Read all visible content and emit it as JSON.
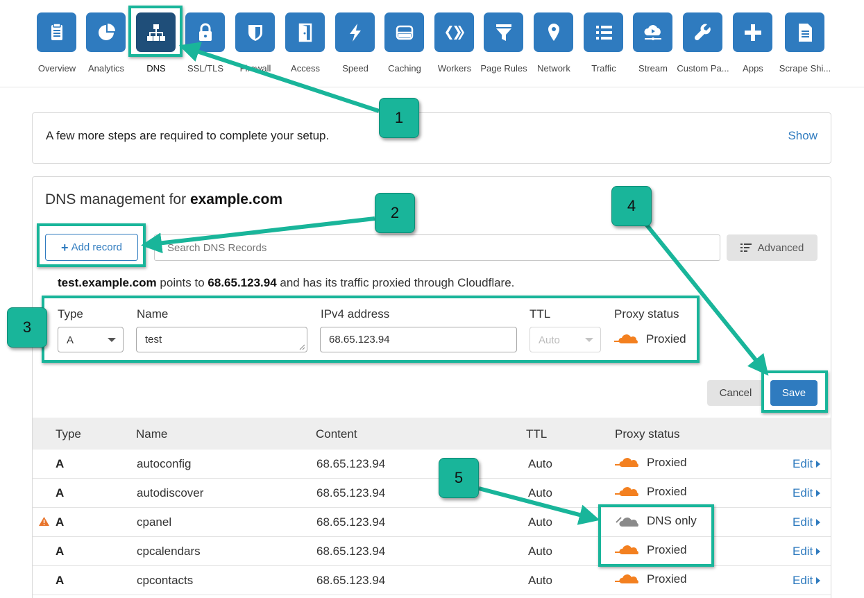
{
  "nav": {
    "items": [
      {
        "label": "Overview",
        "icon": "document-icon"
      },
      {
        "label": "Analytics",
        "icon": "pie-chart-icon"
      },
      {
        "label": "DNS",
        "icon": "network-tree-icon"
      },
      {
        "label": "SSL/TLS",
        "icon": "lock-icon"
      },
      {
        "label": "Firewall",
        "icon": "shield-icon"
      },
      {
        "label": "Access",
        "icon": "door-icon"
      },
      {
        "label": "Speed",
        "icon": "lightning-icon"
      },
      {
        "label": "Caching",
        "icon": "drive-icon"
      },
      {
        "label": "Workers",
        "icon": "workers-chevrons-icon"
      },
      {
        "label": "Page Rules",
        "icon": "filter-icon"
      },
      {
        "label": "Network",
        "icon": "location-pin-icon"
      },
      {
        "label": "Traffic",
        "icon": "list-icon"
      },
      {
        "label": "Stream",
        "icon": "cloud-stream-icon"
      },
      {
        "label": "Custom Pa...",
        "icon": "wrench-icon"
      },
      {
        "label": "Apps",
        "icon": "plus-icon"
      },
      {
        "label": "Scrape Shi...",
        "icon": "page-icon"
      }
    ],
    "active": "DNS"
  },
  "banner": {
    "text": "A few more steps are required to complete your setup.",
    "show_label": "Show"
  },
  "dns": {
    "title_prefix": "DNS management for ",
    "domain": "example.com",
    "add_record_label": "Add record",
    "add_record_plus": "+",
    "search_placeholder": "Search DNS Records",
    "advanced_label": "Advanced",
    "points": {
      "host": "test.example.com",
      "mid": " points to ",
      "ip": "68.65.123.94",
      "tail": " and has its traffic proxied through Cloudflare."
    },
    "form": {
      "type_label": "Type",
      "type_value": "A",
      "name_label": "Name",
      "name_value": "test",
      "ipv4_label": "IPv4 address",
      "ipv4_value": "68.65.123.94",
      "ttl_label": "TTL",
      "ttl_value": "Auto",
      "proxy_label": "Proxy status",
      "proxy_value": "Proxied"
    },
    "cancel_label": "Cancel",
    "save_label": "Save"
  },
  "table": {
    "headers": {
      "type": "Type",
      "name": "Name",
      "content": "Content",
      "ttl": "TTL",
      "proxy": "Proxy status"
    },
    "edit_label": "Edit",
    "rows": [
      {
        "type": "A",
        "name": "autoconfig",
        "content": "68.65.123.94",
        "ttl": "Auto",
        "proxy": "Proxied",
        "warning": false
      },
      {
        "type": "A",
        "name": "autodiscover",
        "content": "68.65.123.94",
        "ttl": "Auto",
        "proxy": "Proxied",
        "warning": false
      },
      {
        "type": "A",
        "name": "cpanel",
        "content": "68.65.123.94",
        "ttl": "Auto",
        "proxy": "DNS only",
        "warning": true
      },
      {
        "type": "A",
        "name": "cpcalendars",
        "content": "68.65.123.94",
        "ttl": "Auto",
        "proxy": "Proxied",
        "warning": false
      },
      {
        "type": "A",
        "name": "cpcontacts",
        "content": "68.65.123.94",
        "ttl": "Auto",
        "proxy": "Proxied",
        "warning": false
      }
    ]
  },
  "callouts": [
    "1",
    "2",
    "3",
    "4",
    "5"
  ],
  "colors": {
    "accent": "#2f7bbf",
    "nav_active": "#1f4e79",
    "annotation": "#19b59a",
    "proxied_cloud": "#f38020",
    "dns_only_cloud": "#8a8a8a",
    "warning": "#e8742c"
  }
}
